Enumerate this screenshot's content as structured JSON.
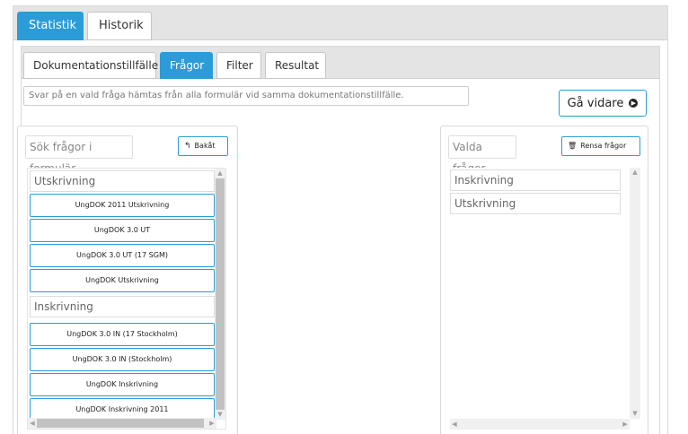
{
  "main_tabs": [
    {
      "label": "Statistik",
      "active": true
    },
    {
      "label": "Historik",
      "active": false
    }
  ],
  "sub_tabs": [
    {
      "label": "Dokumentationstillfälle",
      "active": false
    },
    {
      "label": "Frågor",
      "active": true
    },
    {
      "label": "Filter",
      "active": false
    },
    {
      "label": "Resultat",
      "active": false
    }
  ],
  "info": {
    "text": "Svar på en vald fråga hämtas från alla formulär vid samma dokumentationstillfälle."
  },
  "next_button": {
    "label": "Gå vidare",
    "icon": "arrow-right-circle-icon"
  },
  "left_panel": {
    "search_label": "Sök frågor i formulär",
    "back_button": {
      "label": "Bakåt",
      "icon": "back-arrow-icon"
    },
    "groups": [
      {
        "header": "Utskrivning",
        "items": [
          "UngDOK 2011 Utskrivning",
          "UngDOK 3.0 UT",
          "UngDOK 3.0 UT (17 SGM)",
          "UngDOK Utskrivning"
        ]
      },
      {
        "header": "Inskrivning",
        "items": [
          "UngDOK 3.0 IN (17 Stockholm)",
          "UngDOK 3.0 IN (Stockholm)",
          "UngDOK Inskrivning",
          "UngDOK Inskrivning 2011"
        ]
      }
    ]
  },
  "right_panel": {
    "title": "Valda frågor",
    "clear_button": {
      "label": "Rensa frågor",
      "icon": "trash-icon"
    },
    "selected": [
      "Inskrivning",
      "Utskrivning"
    ]
  },
  "colors": {
    "accent": "#2b9cd8",
    "tabbar": "#e4e4e4"
  }
}
